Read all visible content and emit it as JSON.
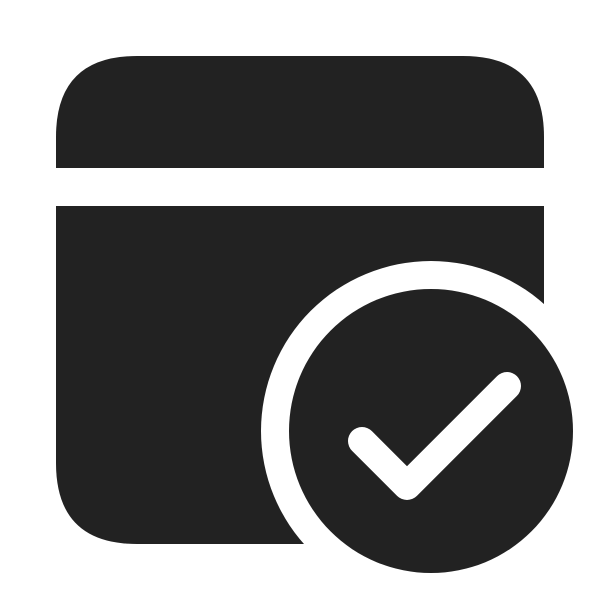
{
  "icon": {
    "name": "calendar-checkmark-icon",
    "colors": {
      "glyph": "#222222",
      "background": "#ffffff"
    },
    "parts": {
      "calendar": "calendar-icon",
      "badge": "checkmark-circle-icon"
    }
  }
}
